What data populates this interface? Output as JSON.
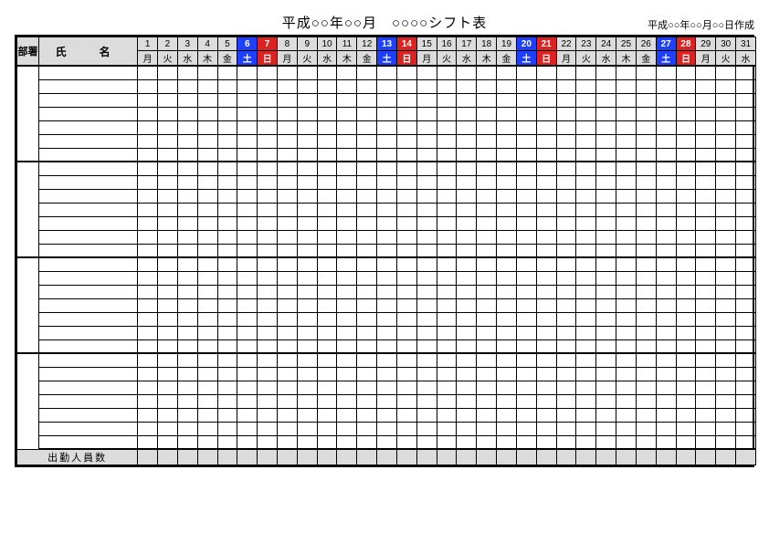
{
  "title": "平成○○年○○月　○○○○シフト表",
  "created": "平成○○年○○月○○日作成",
  "header": {
    "dept": "部署",
    "name": "氏　名"
  },
  "days": [
    {
      "num": "1",
      "wk": "月",
      "type": ""
    },
    {
      "num": "2",
      "wk": "火",
      "type": ""
    },
    {
      "num": "3",
      "wk": "水",
      "type": ""
    },
    {
      "num": "4",
      "wk": "木",
      "type": ""
    },
    {
      "num": "5",
      "wk": "金",
      "type": ""
    },
    {
      "num": "6",
      "wk": "土",
      "type": "sat"
    },
    {
      "num": "7",
      "wk": "日",
      "type": "sun"
    },
    {
      "num": "8",
      "wk": "月",
      "type": ""
    },
    {
      "num": "9",
      "wk": "火",
      "type": ""
    },
    {
      "num": "10",
      "wk": "水",
      "type": ""
    },
    {
      "num": "11",
      "wk": "木",
      "type": ""
    },
    {
      "num": "12",
      "wk": "金",
      "type": ""
    },
    {
      "num": "13",
      "wk": "土",
      "type": "sat"
    },
    {
      "num": "14",
      "wk": "日",
      "type": "sun"
    },
    {
      "num": "15",
      "wk": "月",
      "type": ""
    },
    {
      "num": "16",
      "wk": "火",
      "type": ""
    },
    {
      "num": "17",
      "wk": "水",
      "type": ""
    },
    {
      "num": "18",
      "wk": "木",
      "type": ""
    },
    {
      "num": "19",
      "wk": "金",
      "type": ""
    },
    {
      "num": "20",
      "wk": "土",
      "type": "sat"
    },
    {
      "num": "21",
      "wk": "日",
      "type": "sun"
    },
    {
      "num": "22",
      "wk": "月",
      "type": ""
    },
    {
      "num": "23",
      "wk": "火",
      "type": ""
    },
    {
      "num": "24",
      "wk": "水",
      "type": ""
    },
    {
      "num": "25",
      "wk": "木",
      "type": ""
    },
    {
      "num": "26",
      "wk": "金",
      "type": ""
    },
    {
      "num": "27",
      "wk": "土",
      "type": "sat"
    },
    {
      "num": "28",
      "wk": "日",
      "type": "sun"
    },
    {
      "num": "29",
      "wk": "月",
      "type": ""
    },
    {
      "num": "30",
      "wk": "火",
      "type": ""
    },
    {
      "num": "31",
      "wk": "水",
      "type": ""
    }
  ],
  "groups": [
    {
      "rows": 7
    },
    {
      "rows": 7
    },
    {
      "rows": 7
    },
    {
      "rows": 7
    }
  ],
  "footer": {
    "label": "出勤人員数"
  }
}
